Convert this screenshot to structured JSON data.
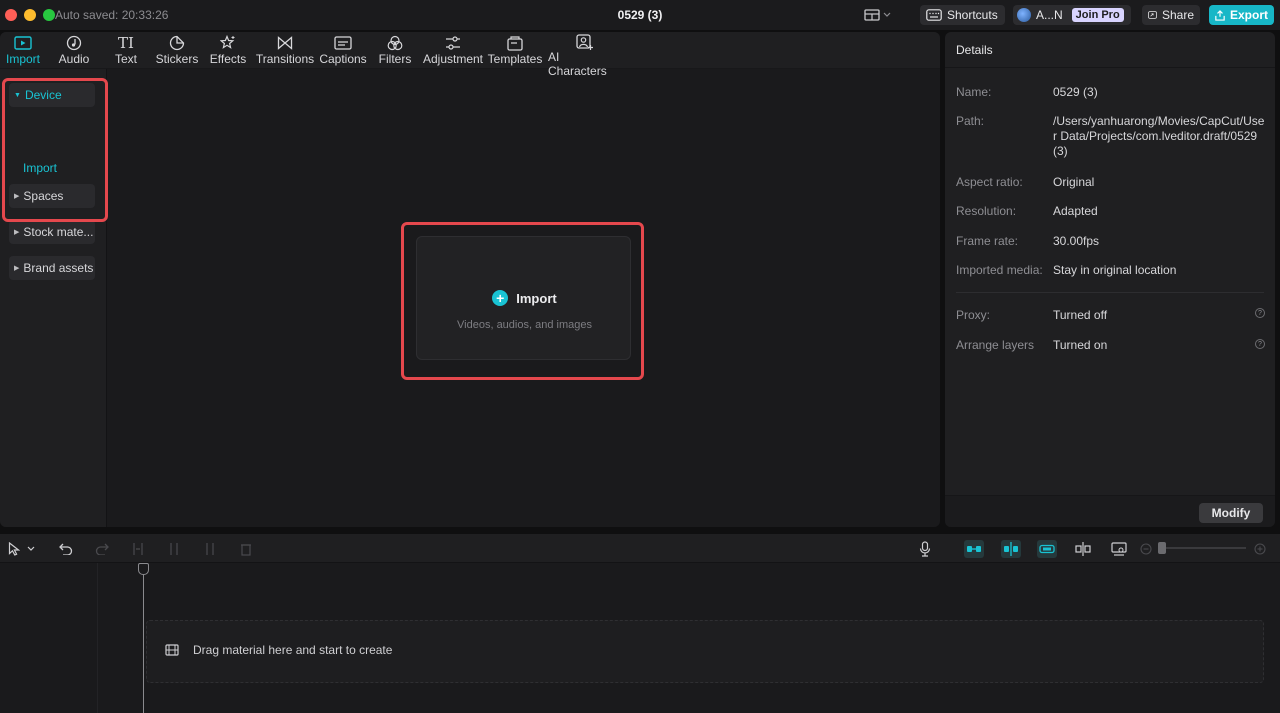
{
  "titlebar": {
    "autosave": "Auto saved: 20:33:26",
    "title": "0529 (3)",
    "shortcuts_label": "Shortcuts",
    "account_name": "A...N",
    "join_pro_label": "Join Pro",
    "share_label": "Share",
    "export_label": "Export"
  },
  "toolbar": {
    "tabs": [
      {
        "label": "Import",
        "icon": "import-icon",
        "active": true
      },
      {
        "label": "Audio",
        "icon": "audio-icon"
      },
      {
        "label": "Text",
        "icon": "text-icon"
      },
      {
        "label": "Stickers",
        "icon": "stickers-icon"
      },
      {
        "label": "Effects",
        "icon": "effects-icon"
      },
      {
        "label": "Transitions",
        "icon": "transitions-icon"
      },
      {
        "label": "Captions",
        "icon": "captions-icon"
      },
      {
        "label": "Filters",
        "icon": "filters-icon"
      },
      {
        "label": "Adjustment",
        "icon": "adjustment-icon"
      },
      {
        "label": "Templates",
        "icon": "templates-icon"
      },
      {
        "label": "AI Characters",
        "icon": "ai-characters-icon"
      }
    ]
  },
  "sidebar": {
    "device": "Device",
    "import": "Import",
    "spaces": "Spaces",
    "stock": "Stock mate...",
    "brand": "Brand assets"
  },
  "import_card": {
    "title": "Import",
    "hint": "Videos, audios, and images"
  },
  "details": {
    "header": "Details",
    "name_label": "Name:",
    "name_value": "0529 (3)",
    "path_label": "Path:",
    "path_value": "/Users/yanhuarong/Movies/CapCut/User Data/Projects/com.lveditor.draft/0529 (3)",
    "aspect_label": "Aspect ratio:",
    "aspect_value": "Original",
    "resolution_label": "Resolution:",
    "resolution_value": "Adapted",
    "framerate_label": "Frame rate:",
    "framerate_value": "30.00fps",
    "imported_label": "Imported media:",
    "imported_value": "Stay in original location",
    "proxy_label": "Proxy:",
    "proxy_value": "Turned off",
    "arrange_label": "Arrange layers",
    "arrange_value": "Turned on",
    "modify_label": "Modify"
  },
  "timeline": {
    "drop_text": "Drag material here and start to create"
  },
  "colors": {
    "accent": "#19c3d3",
    "highlight": "#e5484d"
  }
}
